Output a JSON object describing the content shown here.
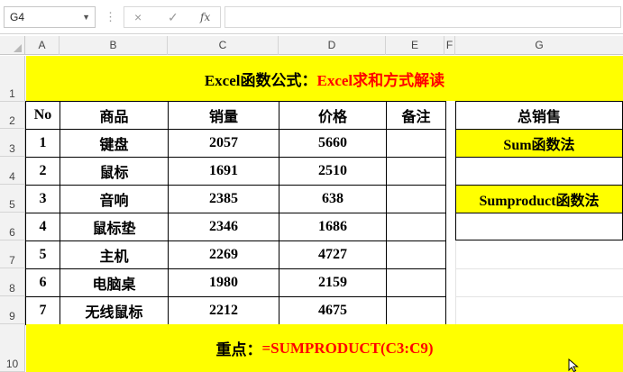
{
  "formula_bar": {
    "name_box": "G4",
    "separator": "⋮",
    "cancel_icon": "×",
    "enter_icon": "✓",
    "fx_label": "fx",
    "formula_value": ""
  },
  "columns": [
    "A",
    "B",
    "C",
    "D",
    "E",
    "F",
    "G"
  ],
  "rows": [
    "1",
    "2",
    "3",
    "4",
    "5",
    "6",
    "7",
    "8",
    "9",
    "10"
  ],
  "title": {
    "black": "Excel函数公式：",
    "red": "Excel求和方式解读"
  },
  "table": {
    "headers": [
      "No",
      "商品",
      "销量",
      "价格",
      "备注"
    ],
    "rows": [
      [
        "1",
        "键盘",
        "2057",
        "5660",
        ""
      ],
      [
        "2",
        "鼠标",
        "1691",
        "2510",
        ""
      ],
      [
        "3",
        "音响",
        "2385",
        "638",
        ""
      ],
      [
        "4",
        "鼠标垫",
        "2346",
        "1686",
        ""
      ],
      [
        "5",
        "主机",
        "2269",
        "4727",
        ""
      ],
      [
        "6",
        "电脑桌",
        "1980",
        "2159",
        ""
      ],
      [
        "7",
        "无线鼠标",
        "2212",
        "4675",
        ""
      ]
    ]
  },
  "side": {
    "header": "总销售",
    "sum_label": "Sum函数法",
    "sum_value": "",
    "sumproduct_label": "Sumproduct函数法",
    "sumproduct_value": ""
  },
  "footer": {
    "black": "重点：",
    "red": "=SUMPRODUCT(C3:C9)"
  },
  "colors": {
    "highlight": "#ffff00",
    "accent_red": "#ff0000"
  }
}
